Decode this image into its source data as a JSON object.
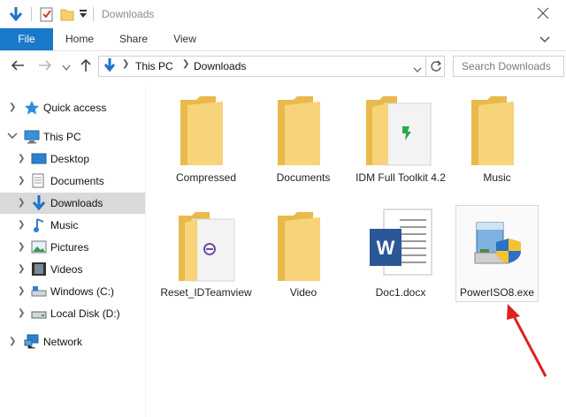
{
  "window": {
    "title": "Downloads"
  },
  "ribbon": {
    "tabs": [
      "File",
      "Home",
      "Share",
      "View"
    ]
  },
  "address": {
    "crumbs": [
      "This PC",
      "Downloads"
    ],
    "search_placeholder": "Search Downloads"
  },
  "nav": {
    "quick_access": "Quick access",
    "this_pc": "This PC",
    "items": [
      "Desktop",
      "Documents",
      "Downloads",
      "Music",
      "Pictures",
      "Videos",
      "Windows (C:)",
      "Local Disk (D:)"
    ],
    "network": "Network"
  },
  "files": {
    "row1": [
      "Compressed",
      "Documents",
      "IDM Full Toolkit 4.2",
      "Music"
    ],
    "row2": [
      "Reset_IDTeamview",
      "Video",
      "Doc1.docx",
      "PowerISO8.exe"
    ]
  },
  "colors": {
    "accent": "#1979ca",
    "folder": "#f7d47a",
    "folder_dark": "#e9b94c",
    "arrow": "#e02020"
  }
}
